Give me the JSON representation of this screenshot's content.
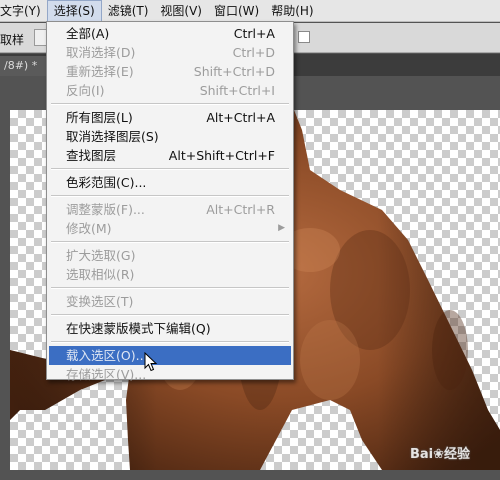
{
  "menubar": {
    "items": [
      "文字(Y)",
      "选择(S)",
      "滤镜(T)",
      "视图(V)",
      "窗口(W)",
      "帮助(H)"
    ],
    "active_index": 1
  },
  "options_bar": {
    "label": "取样"
  },
  "document_tab": {
    "title": "/8#) *",
    "close": "×"
  },
  "watermark": "Bai❀经验",
  "select_menu": {
    "all": {
      "label": "全部(A)",
      "shortcut": "Ctrl+A"
    },
    "deselect": {
      "label": "取消选择(D)",
      "shortcut": "Ctrl+D"
    },
    "reselect": {
      "label": "重新选择(E)",
      "shortcut": "Shift+Ctrl+D"
    },
    "inverse": {
      "label": "反向(I)",
      "shortcut": "Shift+Ctrl+I"
    },
    "all_layers": {
      "label": "所有图层(L)",
      "shortcut": "Alt+Ctrl+A"
    },
    "deselect_layers": {
      "label": "取消选择图层(S)"
    },
    "find_layers": {
      "label": "查找图层",
      "shortcut": "Alt+Shift+Ctrl+F"
    },
    "color_range": {
      "label": "色彩范围(C)..."
    },
    "refine_mask": {
      "label": "调整蒙版(F)...",
      "shortcut": "Alt+Ctrl+R"
    },
    "modify": {
      "label": "修改(M)"
    },
    "grow": {
      "label": "扩大选取(G)"
    },
    "similar": {
      "label": "选取相似(R)"
    },
    "transform": {
      "label": "变换选区(T)"
    },
    "quick_mask": {
      "label": "在快速蒙版模式下编辑(Q)"
    },
    "load": {
      "label": "载入选区(O)..."
    },
    "save": {
      "label": "存储选区(V)..."
    }
  },
  "colors": {
    "highlight": "#3b6ec3",
    "menu_bg": "#f3f3f3",
    "disabled_text": "#9c9c9c"
  }
}
